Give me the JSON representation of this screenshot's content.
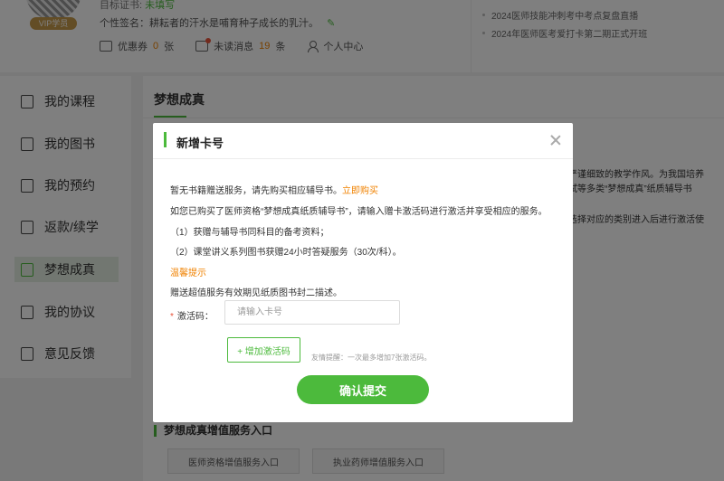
{
  "profile": {
    "vip_badge": "VIP学员",
    "goal_label": "目标证书:",
    "goal_value": "未填写",
    "signature": "个性签名：耕耘者的汗水是哺育种子成长的乳汁。",
    "coupon_label": "优惠券",
    "coupon_count": "0",
    "coupon_unit": "张",
    "unread_label": "未读消息",
    "unread_count": "19",
    "unread_unit": "条",
    "personal_center": "个人中心"
  },
  "news": [
    "2024医师技能冲刺考中考点复盘直播",
    "2024年医师医考爱打卡第二期正式开班"
  ],
  "sidebar": {
    "items": [
      {
        "label": "我的课程",
        "icon": "bookmark-icon"
      },
      {
        "label": "我的图书",
        "icon": "book-icon"
      },
      {
        "label": "我的预约",
        "icon": "calendar-icon"
      },
      {
        "label": "返款/续学",
        "icon": "refund-icon"
      },
      {
        "label": "梦想成真",
        "icon": "paper-plane-icon"
      },
      {
        "label": "我的协议",
        "icon": "document-icon"
      },
      {
        "label": "意见反馈",
        "icon": "feedback-icon"
      }
    ],
    "active_index": 4
  },
  "main": {
    "title": "梦想成真",
    "text_lines": [
      "严谨细致的教学作风。为我国培养",
      "试等多类“梦想成真”纸质辅导书",
      "选择对应的类别进入后进行激活使"
    ],
    "service_title": "梦想成真增值服务入口",
    "service_buttons": [
      "医师资格增值服务入口",
      "执业药师增值服务入口"
    ]
  },
  "modal": {
    "title": "新增卡号",
    "line1": "暂无书籍赠送服务，请先购买相应辅导书。",
    "buy_link": "立即购买",
    "line2": "如您已购买了医师资格“梦想成真纸质辅导书”，请输入赠卡激活码进行激活并享受相应的服务。",
    "line3": "（1）获赠与辅导书同科目的备考资料；",
    "line4": "（2）课堂讲义系列图书获赠24小时答疑服务（30次/科）。",
    "tip_title": "温馨提示",
    "line5": "赠送超值服务有效期见纸质图书封二描述。",
    "code_label": "激活码：",
    "code_placeholder": "请输入卡号",
    "code_value": "",
    "add_button": "+ 增加激活码",
    "add_hint": "友情提醒：一次最多增加7张激活码。",
    "confirm_button": "确认提交"
  },
  "colors": {
    "accent": "#4cba3c",
    "highlight": "#f08200"
  }
}
